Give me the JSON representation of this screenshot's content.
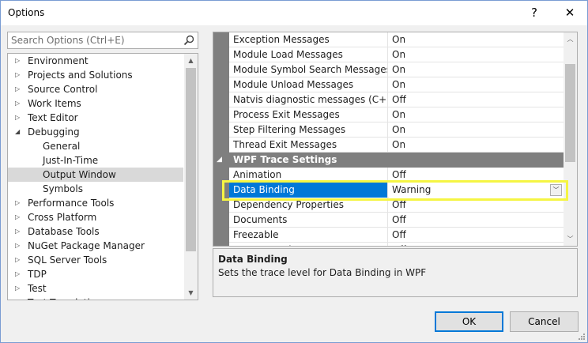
{
  "window": {
    "title": "Options",
    "help_glyph": "?",
    "close_glyph": "✕"
  },
  "search": {
    "placeholder": "Search Options (Ctrl+E)",
    "icon": "search-icon"
  },
  "tree": {
    "items": [
      {
        "label": "Environment",
        "expander": "▷",
        "level": 0
      },
      {
        "label": "Projects and Solutions",
        "expander": "▷",
        "level": 0
      },
      {
        "label": "Source Control",
        "expander": "▷",
        "level": 0
      },
      {
        "label": "Work Items",
        "expander": "▷",
        "level": 0
      },
      {
        "label": "Text Editor",
        "expander": "▷",
        "level": 0
      },
      {
        "label": "Debugging",
        "expander": "◢",
        "level": 0
      },
      {
        "label": "General",
        "level": 1
      },
      {
        "label": "Just-In-Time",
        "level": 1
      },
      {
        "label": "Output Window",
        "level": 1,
        "selected": true
      },
      {
        "label": "Symbols",
        "level": 1
      },
      {
        "label": "Performance Tools",
        "expander": "▷",
        "level": 0
      },
      {
        "label": "Cross Platform",
        "expander": "▷",
        "level": 0
      },
      {
        "label": "Database Tools",
        "expander": "▷",
        "level": 0
      },
      {
        "label": "NuGet Package Manager",
        "expander": "▷",
        "level": 0
      },
      {
        "label": "SQL Server Tools",
        "expander": "▷",
        "level": 0
      },
      {
        "label": "TDP",
        "expander": "▷",
        "level": 0
      },
      {
        "label": "Test",
        "expander": "▷",
        "level": 0
      },
      {
        "label": "Text Templating",
        "expander": "▷",
        "level": 0
      }
    ],
    "scroll_up": "▲",
    "scroll_down": "▼"
  },
  "grid": {
    "rows": [
      {
        "name": "Exception Messages",
        "value": "On"
      },
      {
        "name": "Module Load Messages",
        "value": "On"
      },
      {
        "name": "Module Symbol Search Messages",
        "value": "On"
      },
      {
        "name": "Module Unload Messages",
        "value": "On"
      },
      {
        "name": "Natvis diagnostic messages (C++ only)",
        "value": "Off"
      },
      {
        "name": "Process Exit Messages",
        "value": "On"
      },
      {
        "name": "Step Filtering Messages",
        "value": "On"
      },
      {
        "name": "Thread Exit Messages",
        "value": "On"
      }
    ],
    "category": {
      "label": "WPF Trace Settings",
      "expander": "◢"
    },
    "wpf_rows": [
      {
        "name": "Animation",
        "value": "Off"
      },
      {
        "name": "Data Binding",
        "value": "Warning",
        "selected": true
      },
      {
        "name": "Dependency Properties",
        "value": "Off"
      },
      {
        "name": "Documents",
        "value": "Off"
      },
      {
        "name": "Freezable",
        "value": "Off"
      },
      {
        "name": "HWND Hosting",
        "value": "Off"
      }
    ],
    "dropdown_glyph": "﹀",
    "scroll_up": "︿",
    "scroll_down": "﹀"
  },
  "description": {
    "title": "Data Binding",
    "text": "Sets the trace level for Data Binding in WPF"
  },
  "buttons": {
    "ok": "OK",
    "cancel": "Cancel"
  },
  "colors": {
    "selection": "#0078d7",
    "highlight": "#f5f543",
    "category": "#7f7f7f"
  }
}
